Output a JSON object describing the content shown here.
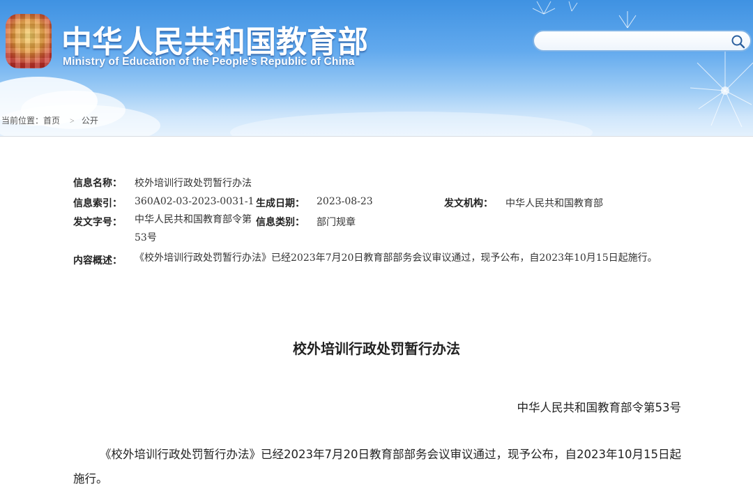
{
  "site": {
    "title_cn": "中华人民共和国教育部",
    "title_en": "Ministry of Education of the People's Republic of China",
    "emblem": "national-emblem-icon"
  },
  "search": {
    "value": "",
    "placeholder": "",
    "icon": "search-icon"
  },
  "breadcrumb": {
    "label": "当前位置：",
    "items": [
      "首页",
      "公开"
    ],
    "separator": ">"
  },
  "info": {
    "name_label": "信息名称：",
    "name_value": "校外培训行政处罚暂行办法",
    "index_label": "信息索引：",
    "index_value": "360A02-03-2023-0031-1",
    "date_label": "生成日期：",
    "date_value": "2023-08-23",
    "issuer_label": "发文机构：",
    "issuer_value": "中华人民共和国教育部",
    "docno_label": "发文字号：",
    "docno_value": "中华人民共和国教育部令第53号",
    "category_label": "信息类别：",
    "category_value": "部门规章",
    "summary_label": "内容概述：",
    "summary_value": "《校外培训行政处罚暂行办法》已经2023年7月20日教育部部务会议审议通过，现予公布，自2023年10月15日起施行。"
  },
  "document": {
    "title": "校外培训行政处罚暂行办法",
    "number": "中华人民共和国教育部令第53号",
    "body": "《校外培训行政处罚暂行办法》已经2023年7月20日教育部部务会议审议通过，现予公布，自2023年10月15日起施行。"
  },
  "colors": {
    "header_top": "#3f92e2",
    "header_bottom": "#e4f1fd",
    "emblem_red": "#c9362c",
    "emblem_gold": "#f6d36b"
  }
}
